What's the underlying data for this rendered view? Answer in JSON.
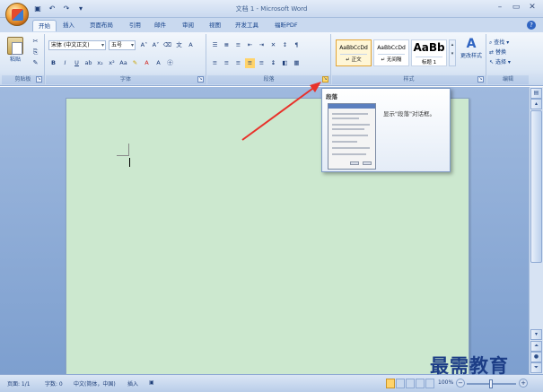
{
  "window": {
    "title": "文档 1 - Microsoft Word"
  },
  "tabs": [
    {
      "label": "开始",
      "active": true
    },
    {
      "label": "插入"
    },
    {
      "label": "页面布局"
    },
    {
      "label": "引用"
    },
    {
      "label": "邮件"
    },
    {
      "label": "审阅"
    },
    {
      "label": "视图"
    },
    {
      "label": "开发工具"
    },
    {
      "label": "福昕PDF"
    }
  ],
  "ribbon": {
    "clipboard": {
      "label": "剪贴板",
      "paste_label": "粘贴"
    },
    "font": {
      "label": "字体",
      "font_name": "宋体 (中文正文)",
      "font_size": "五号"
    },
    "paragraph": {
      "label": "段落"
    },
    "styles": {
      "label": "样式",
      "items": [
        {
          "sample": "AaBbCcDd",
          "name": "↵ 正文",
          "selected": true
        },
        {
          "sample": "AaBbCcDd",
          "name": "↵ 无间隔"
        },
        {
          "sample": "AaBb",
          "name": "标题 1"
        }
      ],
      "change_styles": "更改样式"
    },
    "editing": {
      "label": "编辑",
      "find": "查找",
      "replace": "替换",
      "select": "选择"
    }
  },
  "tooltip": {
    "title": "段落",
    "description": "显示\"段落\"对话框。"
  },
  "statusbar": {
    "page": "页面: 1/1",
    "words": "字数: 0",
    "language": "中文(简体，中国)",
    "mode": "插入",
    "zoom": "100%"
  },
  "watermark": "最需教育",
  "colors": {
    "accent": "#15428b",
    "page": "#cce8cf",
    "arrow": "#e8312a"
  }
}
